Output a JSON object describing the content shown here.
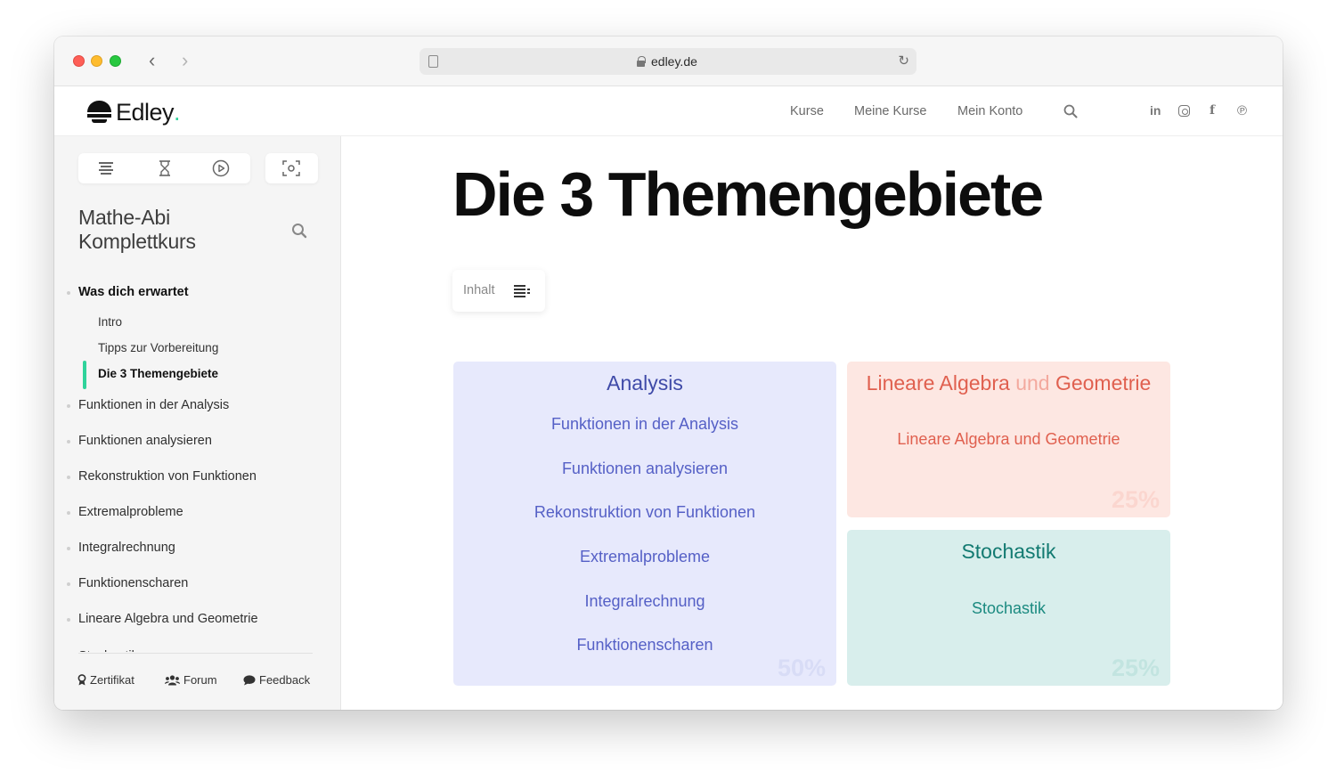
{
  "browser": {
    "url": "edley.de"
  },
  "header": {
    "logo_text": "Edley",
    "logo_dot": ".",
    "nav": [
      "Kurse",
      "Meine Kurse",
      "Mein Konto"
    ],
    "social_linkedin": "in",
    "social_facebook": "f",
    "social_pinterest": "℗"
  },
  "sidebar": {
    "course_title_line1": "Mathe-Abi",
    "course_title_line2": "Komplettkurs",
    "active_chapter": "Was dich erwartet",
    "subitems": [
      "Intro",
      "Tipps zur Vorbereitung",
      "Die 3 Themengebiete"
    ],
    "chapters": [
      "Funktionen in der Analysis",
      "Funktionen analysieren",
      "Rekonstruktion von Funktionen",
      "Extremalprobleme",
      "Integralrechnung",
      "Funktionenscharen",
      "Lineare Algebra und Geometrie"
    ],
    "cut_off_item": "Stochastik",
    "footer": {
      "zertifikat": "Zertifikat",
      "forum": "Forum",
      "feedback": "Feedback"
    }
  },
  "main": {
    "title": "Die 3 Themengebiete",
    "toc_label": "Inhalt",
    "cards": {
      "analysis": {
        "title": "Analysis",
        "links": [
          "Funktionen in der Analysis",
          "Funktionen analysieren",
          "Rekonstruktion von Funktionen",
          "Extremalprobleme",
          "Integralrechnung",
          "Funktionenscharen"
        ],
        "percent": "50%"
      },
      "lag": {
        "title_part1": "Lineare Algebra",
        "title_und": "und",
        "title_part2": "Geometrie",
        "link": "Lineare Algebra und Geometrie",
        "percent": "25%"
      },
      "stochastik": {
        "title": "Stochastik",
        "link": "Stochastik",
        "percent": "25%"
      }
    }
  },
  "colors": {
    "accent_green": "#2fd39b",
    "analysis_bg": "#e7e9fc",
    "lag_bg": "#fde7e2",
    "stoch_bg": "#d8eeec"
  }
}
